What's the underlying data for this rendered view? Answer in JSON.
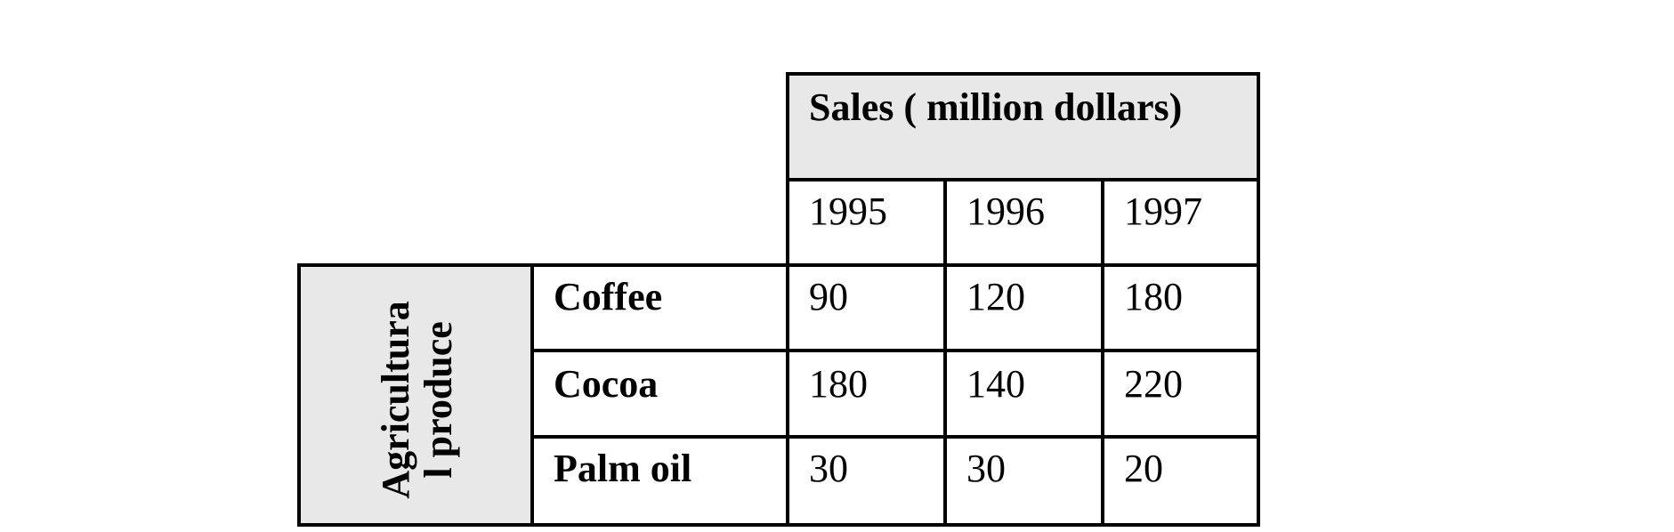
{
  "chart_data": {
    "type": "table",
    "title": "Sales ( million dollars)",
    "row_group_label": [
      "Agricultura",
      "l produce"
    ],
    "columns": [
      "1995",
      "1996",
      "1997"
    ],
    "rows": [
      {
        "label": "Coffee",
        "values": [
          "90",
          "120",
          "180"
        ]
      },
      {
        "label": "Cocoa",
        "values": [
          "180",
          "140",
          "220"
        ]
      },
      {
        "label": "Palm oil",
        "values": [
          "30",
          "30",
          "20"
        ]
      }
    ]
  },
  "colors": {
    "header_fill": "#e8e8e8",
    "border": "#000000"
  }
}
